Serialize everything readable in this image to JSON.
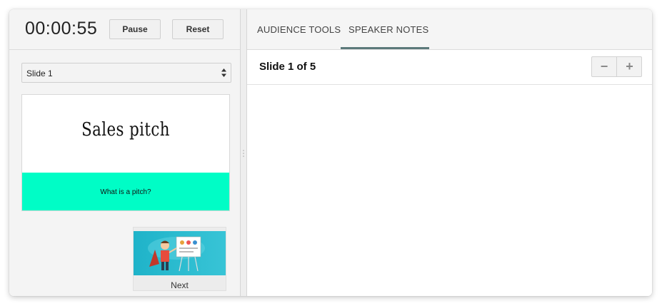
{
  "timer": {
    "value": "00:00:55",
    "pause_label": "Pause",
    "reset_label": "Reset"
  },
  "slide_select": {
    "selected": "Slide 1"
  },
  "current_slide": {
    "title": "Sales pitch",
    "subtitle": "What is a pitch?",
    "band_color": "#00fdc6"
  },
  "next_slide": {
    "label": "Next"
  },
  "tabs": [
    {
      "label": "AUDIENCE TOOLS",
      "active": false
    },
    {
      "label": "SPEAKER NOTES",
      "active": true
    }
  ],
  "notes": {
    "title": "Slide 1 of 5",
    "zoom_out": "−",
    "zoom_in": "+"
  },
  "colors": {
    "accent": "#5c7a7b",
    "panel": "#f4f4f4"
  }
}
